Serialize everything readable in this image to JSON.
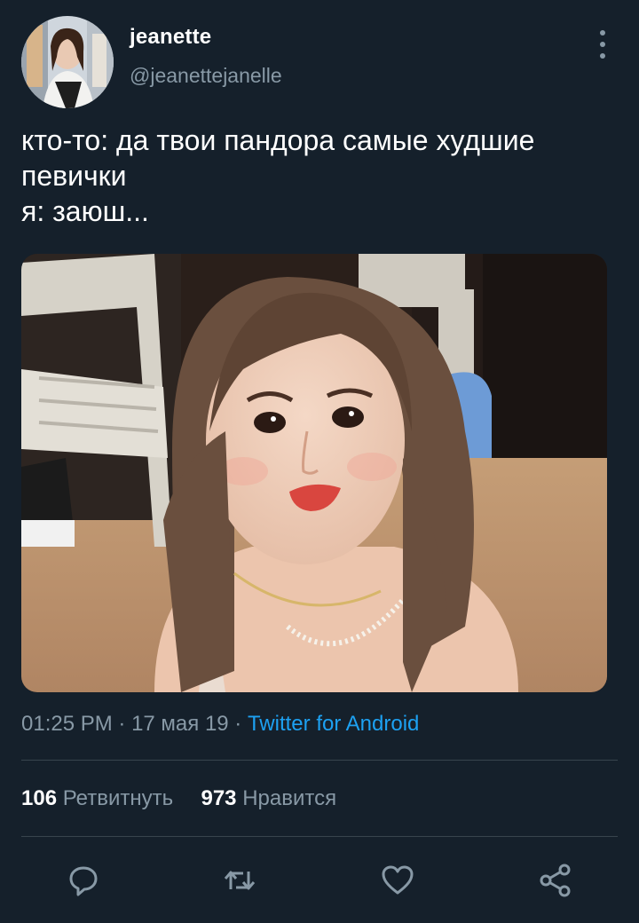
{
  "user": {
    "display_name": "jeanette",
    "handle": "@jeanettejanelle"
  },
  "tweet": {
    "lines": [
      "кто-то: да твои пандора самые худшие",
      "певички",
      "я: заюш..."
    ]
  },
  "meta": {
    "time": "01:25 PM",
    "sep1": " · ",
    "date": "17 мая 19",
    "sep2": " · ",
    "source": "Twitter for Android"
  },
  "stats": {
    "retweets_count": "106",
    "retweets_label": "Ретвитнуть",
    "likes_count": "973",
    "likes_label": "Нравится"
  },
  "icons": {
    "more": "more-vertical-icon",
    "reply": "reply-icon",
    "retweet": "retweet-icon",
    "like": "heart-icon",
    "share": "share-icon"
  },
  "colors": {
    "background": "#15202b",
    "secondary_text": "#8899a6",
    "link": "#1da1f2",
    "divider": "#38444d"
  }
}
